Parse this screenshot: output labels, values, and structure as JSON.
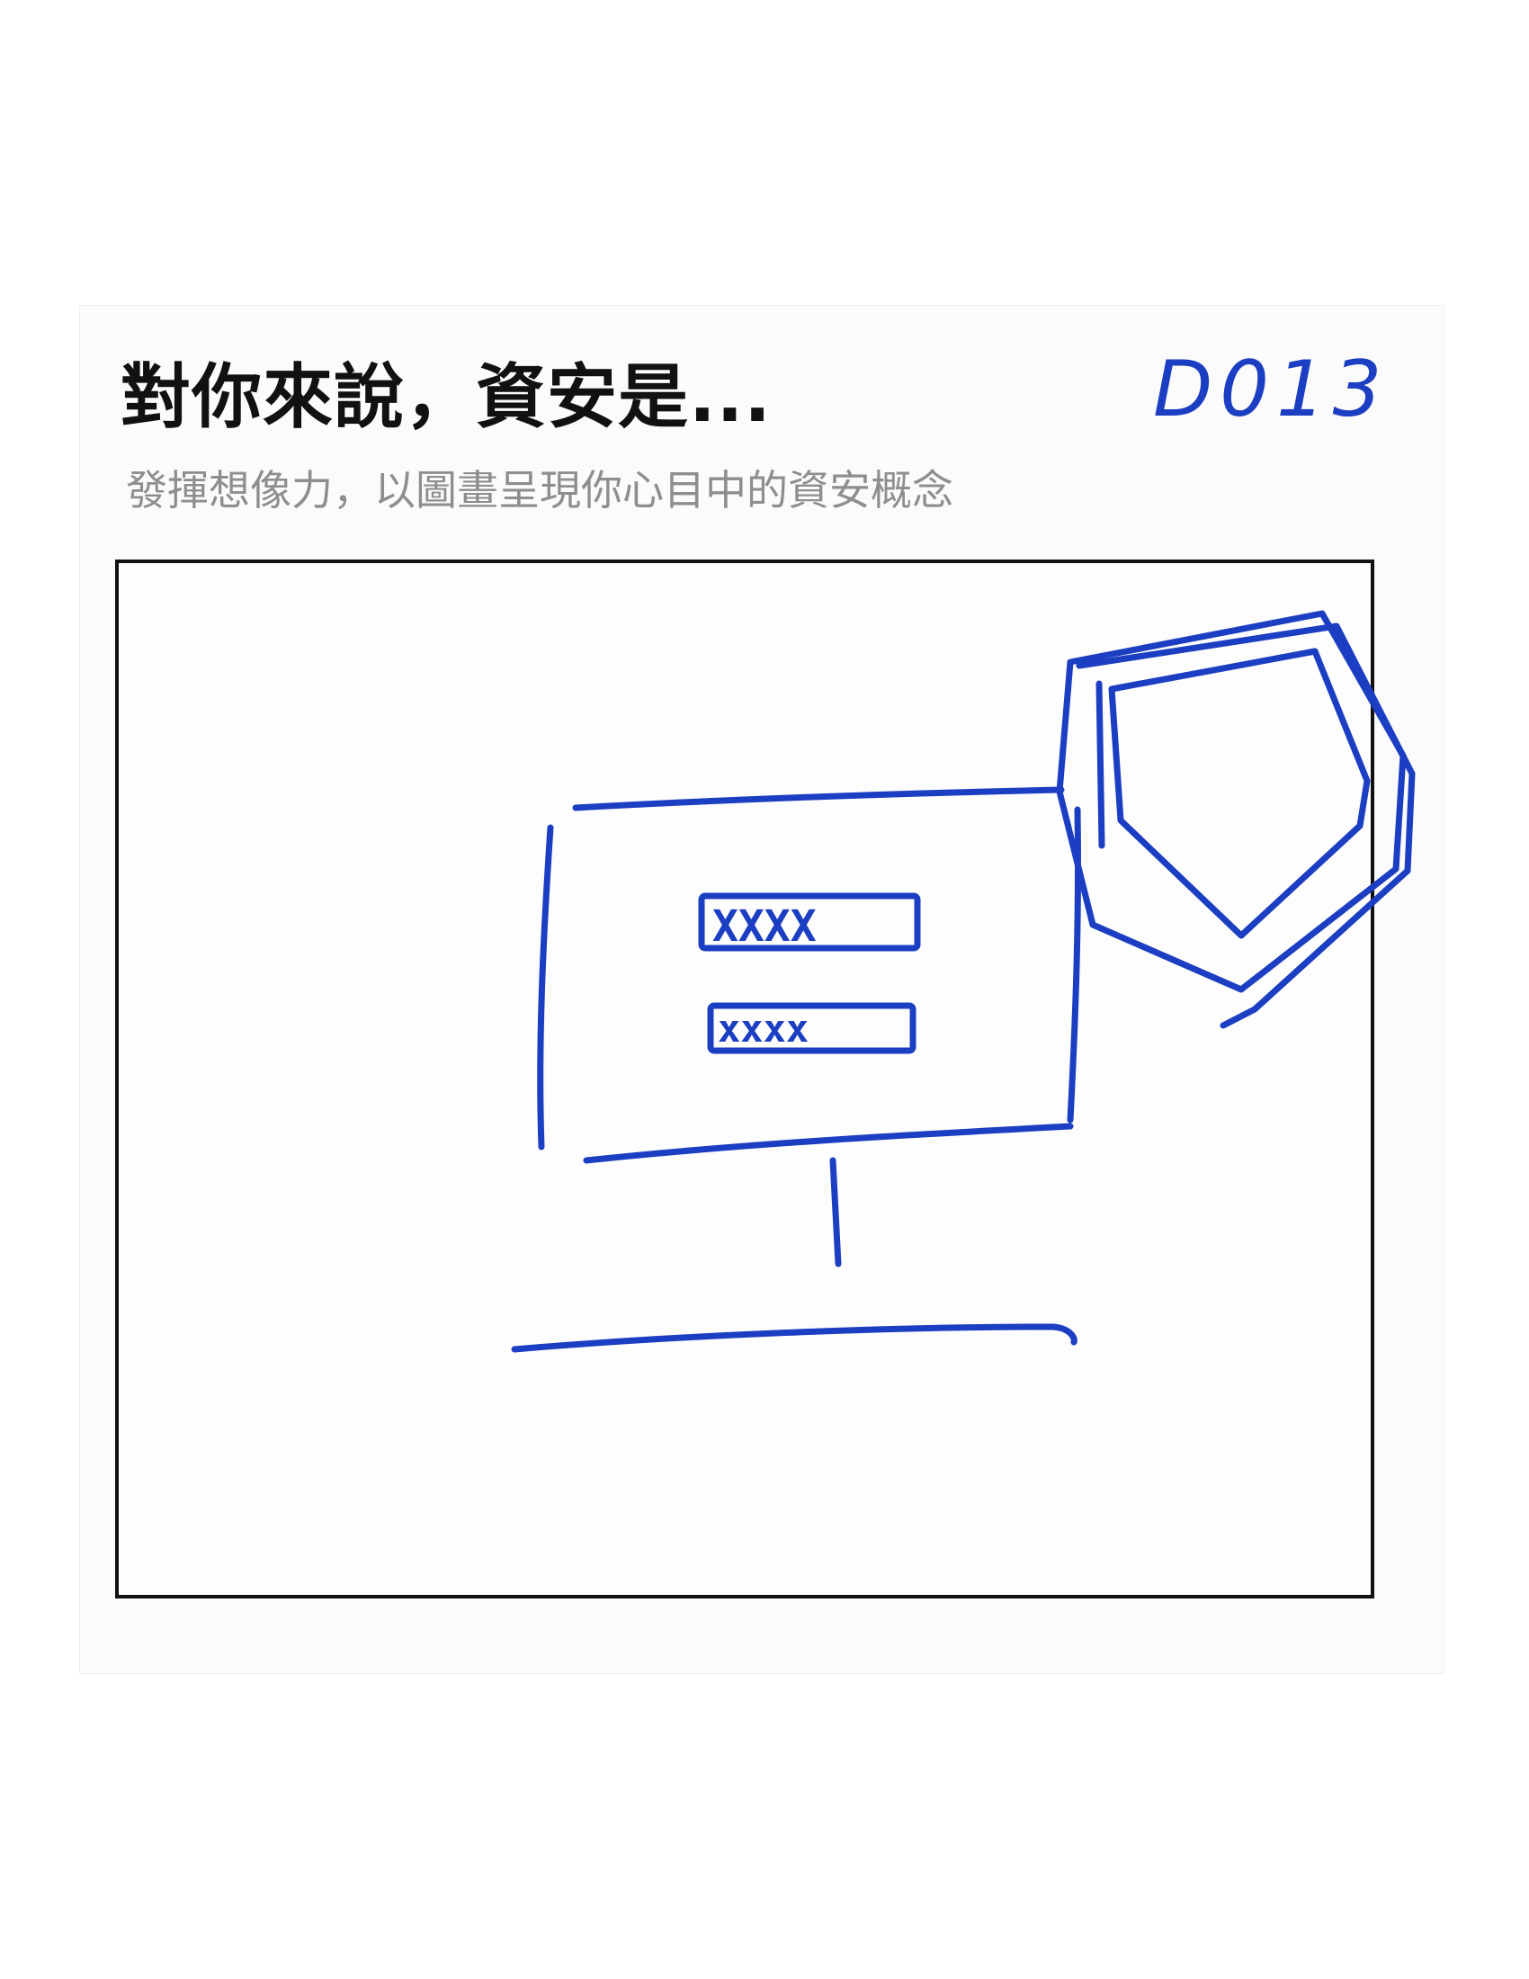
{
  "header": {
    "title": "對你來說，資安是...",
    "subtitle": "發揮想像力，以圖畫呈現你心目中的資安概念",
    "card_id": "D013"
  },
  "drawing": {
    "ink_color": "#1b3ec2",
    "field_1_text": "XXXX",
    "field_2_text": "xxxx"
  }
}
